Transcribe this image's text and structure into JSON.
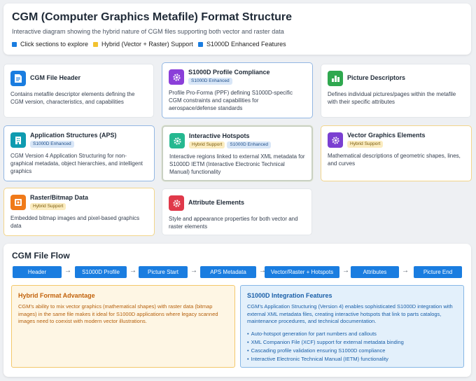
{
  "header": {
    "title": "CGM (Computer Graphics Metafile) Format Structure",
    "subtitle": "Interactive diagram showing the hybrid nature of CGM files supporting both vector and raster data",
    "legend": [
      {
        "label": "Click sections to explore",
        "color": "#1a7de0"
      },
      {
        "label": "Hybrid (Vector + Raster) Support",
        "color": "#f2c230"
      },
      {
        "label": "S1000D Enhanced Features",
        "color": "#1a7de0"
      }
    ]
  },
  "badges": {
    "s1000d": "S1000D Enhanced",
    "hybrid": "Hybrid Support"
  },
  "cards": [
    {
      "title": "CGM File Header",
      "icon": "document-icon",
      "icon_bg": "#1a7de0",
      "type": "plain",
      "desc": "Contains metafile descriptor elements defining the CGM version, characteristics, and capabilities"
    },
    {
      "title": "S1000D Profile Compliance",
      "icon": "gear-icon",
      "icon_bg": "#8b3fd9",
      "type": "s1000d",
      "desc": "Profile Pro-Forma (PPF) defining S1000D-specific CGM constraints and capabilities for aerospace/defense standards"
    },
    {
      "title": "Picture Descriptors",
      "icon": "bar-chart-icon",
      "icon_bg": "#2fa84f",
      "type": "plain",
      "desc": "Defines individual pictures/pages within the metafile with their specific attributes"
    },
    {
      "title": "Application Structures (APS)",
      "icon": "building-icon",
      "icon_bg": "#0f9bb0",
      "type": "s1000d",
      "desc": "CGM Version 4 Application Structuring for non-graphical metadata, object hierarchies, and intelligent graphics"
    },
    {
      "title": "Interactive Hotspots",
      "icon": "gear-icon",
      "icon_bg": "#25b890",
      "type": "both",
      "desc": "Interactive regions linked to external XML metadata for S1000D IETM (Interactive Electronic Technical Manual) functionality"
    },
    {
      "title": "Vector Graphics Elements",
      "icon": "gear-icon",
      "icon_bg": "#7a3fd1",
      "type": "hybrid",
      "desc": "Mathematical descriptions of geometric shapes, lines, and curves"
    },
    {
      "title": "Raster/Bitmap Data",
      "icon": "image-icon",
      "icon_bg": "#f07a1a",
      "type": "hybrid",
      "desc": "Embedded bitmap images and pixel-based graphics data"
    },
    {
      "title": "Attribute Elements",
      "icon": "gear-icon",
      "icon_bg": "#e0394a",
      "type": "plain",
      "desc": "Style and appearance properties for both vector and raster elements"
    }
  ],
  "flow": {
    "title": "CGM File Flow",
    "steps": [
      "Header",
      "S1000D Profile",
      "Picture Start",
      "APS Metadata",
      "Vector/Raster + Hotspots",
      "Attributes",
      "Picture End"
    ],
    "arrow": "→"
  },
  "hybrid_box": {
    "title": "Hybrid Format Advantage",
    "text": "CGM's ability to mix vector graphics (mathematical shapes) with raster data (bitmap images) in the same file makes it ideal for S1000D applications where legacy scanned images need to coexist with modern vector illustrations."
  },
  "s1000d_box": {
    "title": "S1000D Integration Features",
    "text": "CGM's Application Structuring (Version 4) enables sophisticated S1000D integration with external XML metadata files, creating interactive hotspots that link to parts catalogs, maintenance procedures, and technical documentation.",
    "items": [
      "Auto-hotspot generation for part numbers and callouts",
      "XML Companion File (XCF) support for external metadata binding",
      "Cascading profile validation ensuring S1000D compliance",
      "Interactive Electronic Technical Manual (IETM) functionality"
    ]
  }
}
